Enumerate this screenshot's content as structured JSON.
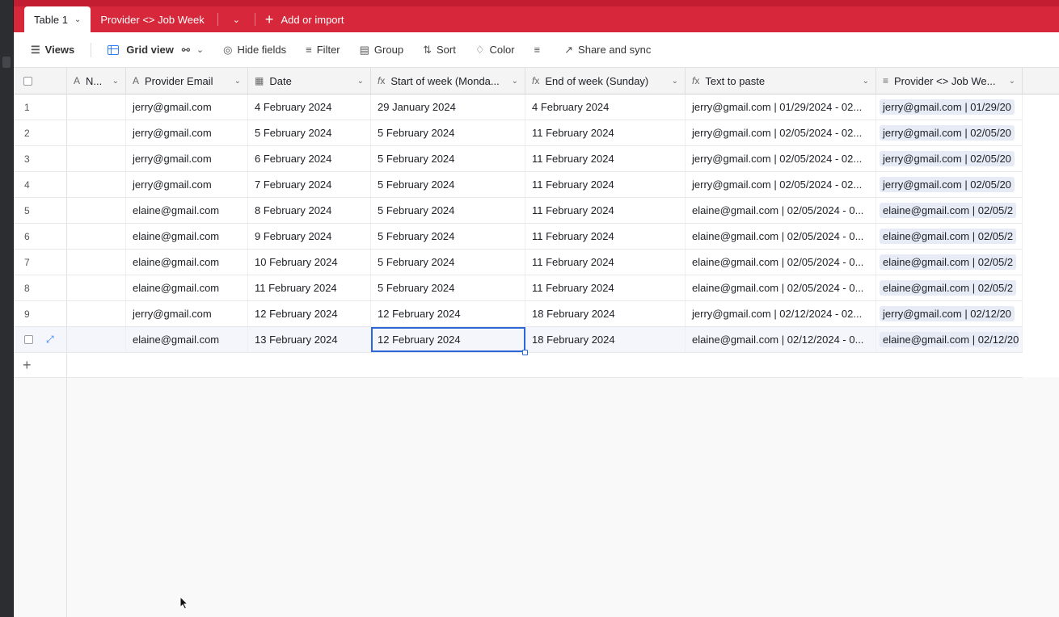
{
  "tabs": {
    "active": {
      "label": "Table 1"
    },
    "second": {
      "label": "Provider <> Job Week"
    },
    "add_import": "Add or import"
  },
  "toolbar": {
    "views": "Views",
    "grid_view": "Grid view",
    "hide_fields": "Hide fields",
    "filter": "Filter",
    "group": "Group",
    "sort": "Sort",
    "color": "Color",
    "share_sync": "Share and sync"
  },
  "columns": [
    {
      "label": "N...",
      "icon": "A"
    },
    {
      "label": "Provider Email",
      "icon": "A"
    },
    {
      "label": "Date",
      "icon": "calendar"
    },
    {
      "label": "Start of week (Monda...",
      "icon": "fx"
    },
    {
      "label": "End of week (Sunday)",
      "icon": "fx"
    },
    {
      "label": "Text to paste",
      "icon": "fx"
    },
    {
      "label": "Provider <> Job We...",
      "icon": "link"
    }
  ],
  "rows": [
    {
      "n": "1",
      "email": "jerry@gmail.com",
      "date": "4 February 2024",
      "start": "29 January 2024",
      "end": "4 February 2024",
      "text": "jerry@gmail.com | 01/29/2024 - 02...",
      "link": "jerry@gmail.com | 01/29/20"
    },
    {
      "n": "2",
      "email": "jerry@gmail.com",
      "date": "5 February 2024",
      "start": "5 February 2024",
      "end": "11 February 2024",
      "text": "jerry@gmail.com | 02/05/2024 - 02...",
      "link": "jerry@gmail.com | 02/05/20"
    },
    {
      "n": "3",
      "email": "jerry@gmail.com",
      "date": "6 February 2024",
      "start": "5 February 2024",
      "end": "11 February 2024",
      "text": "jerry@gmail.com | 02/05/2024 - 02...",
      "link": "jerry@gmail.com | 02/05/20"
    },
    {
      "n": "4",
      "email": "jerry@gmail.com",
      "date": "7 February 2024",
      "start": "5 February 2024",
      "end": "11 February 2024",
      "text": "jerry@gmail.com | 02/05/2024 - 02...",
      "link": "jerry@gmail.com | 02/05/20"
    },
    {
      "n": "5",
      "email": "elaine@gmail.com",
      "date": "8 February 2024",
      "start": "5 February 2024",
      "end": "11 February 2024",
      "text": "elaine@gmail.com | 02/05/2024 - 0...",
      "link": "elaine@gmail.com | 02/05/2"
    },
    {
      "n": "6",
      "email": "elaine@gmail.com",
      "date": "9 February 2024",
      "start": "5 February 2024",
      "end": "11 February 2024",
      "text": "elaine@gmail.com | 02/05/2024 - 0...",
      "link": "elaine@gmail.com | 02/05/2"
    },
    {
      "n": "7",
      "email": "elaine@gmail.com",
      "date": "10 February 2024",
      "start": "5 February 2024",
      "end": "11 February 2024",
      "text": "elaine@gmail.com | 02/05/2024 - 0...",
      "link": "elaine@gmail.com | 02/05/2"
    },
    {
      "n": "8",
      "email": "elaine@gmail.com",
      "date": "11 February 2024",
      "start": "5 February 2024",
      "end": "11 February 2024",
      "text": "elaine@gmail.com | 02/05/2024 - 0...",
      "link": "elaine@gmail.com | 02/05/2"
    },
    {
      "n": "9",
      "email": "jerry@gmail.com",
      "date": "12 February 2024",
      "start": "12 February 2024",
      "end": "18 February 2024",
      "text": "jerry@gmail.com | 02/12/2024 - 02...",
      "link": "jerry@gmail.com | 02/12/20"
    },
    {
      "n": "",
      "email": "elaine@gmail.com",
      "date": "13 February 2024",
      "start": "12 February 2024",
      "end": "18 February 2024",
      "text": "elaine@gmail.com | 02/12/2024 - 0...",
      "link": "elaine@gmail.com | 02/12/20"
    }
  ],
  "colors": {
    "brand": "#d6283a",
    "accent": "#2d66d8"
  }
}
